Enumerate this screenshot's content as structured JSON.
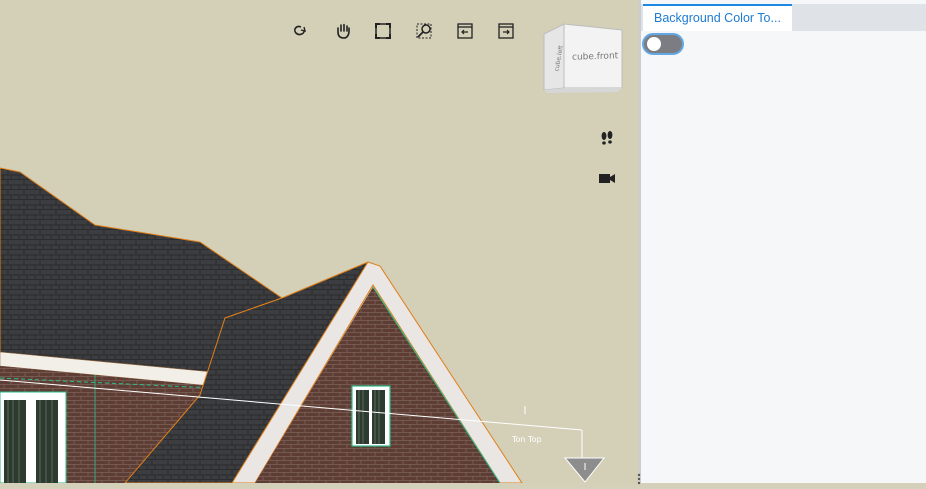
{
  "viewport": {
    "toolbar": [
      {
        "name": "orbit",
        "icon": "orbit-icon"
      },
      {
        "name": "pan",
        "icon": "hand-icon"
      },
      {
        "name": "fit",
        "icon": "fit-view-icon"
      },
      {
        "name": "zoom",
        "icon": "zoom-window-icon"
      },
      {
        "name": "previous-view",
        "icon": "prev-view-icon"
      },
      {
        "name": "next-view",
        "icon": "next-view-icon"
      }
    ],
    "viewcube": {
      "front_label": "cube.front",
      "side_label": "cube.left"
    },
    "side_tools": [
      {
        "name": "walk",
        "icon": "footprints-icon"
      },
      {
        "name": "camera",
        "icon": "camera-icon"
      }
    ],
    "dimension_label": "Ton Top",
    "background_color": "#d4d0b8"
  },
  "panel": {
    "tab_label": "Background Color To...",
    "toggle_on": false,
    "accent_color": "#1e88e5"
  }
}
